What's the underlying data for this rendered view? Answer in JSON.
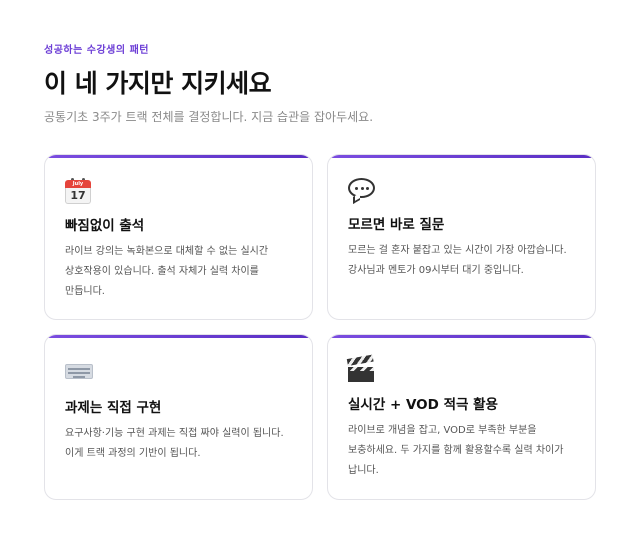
{
  "header": {
    "eyebrow": "성공하는 수강생의 패턴",
    "title": "이 네 가지만 지키세요",
    "subtitle": "공통기초 3주가 트랙 전체를 결정합니다. 지금 습관을 잡아두세요."
  },
  "cards": [
    {
      "icon": "calendar-icon",
      "title": "빠짐없이 출석",
      "description": "라이브 강의는 녹화본으로 대체할 수 없는 실시간 상호작용이 있습니다. 출석 자체가 실력 차이를 만듭니다."
    },
    {
      "icon": "speech-bubble-icon",
      "title": "모르면 바로 질문",
      "description": "모르는 걸 혼자 붙잡고 있는 시간이 가장 아깝습니다. 강사님과 멘토가 09시부터 대기 중입니다."
    },
    {
      "icon": "keyboard-icon",
      "title": "과제는 직접 구현",
      "description": "요구사항·기능 구현 과제는 직접 짜야 실력이 됩니다. 이게 트랙 과정의 기반이 됩니다."
    },
    {
      "icon": "clapperboard-icon",
      "title": "실시간 + VOD 적극 활용",
      "description": "라이브로 개념을 잡고, VOD로 부족한 부분을 보충하세요. 두 가지를 함께 활용할수록 실력 차이가 납니다."
    }
  ],
  "calendar_icon": {
    "month": "July",
    "day": "17"
  },
  "colors": {
    "accent": "#6d3fd6",
    "card_border": "#e3e3e8",
    "title_text": "#111111",
    "body_text": "#555555",
    "calendar_red": "#e5443b"
  }
}
